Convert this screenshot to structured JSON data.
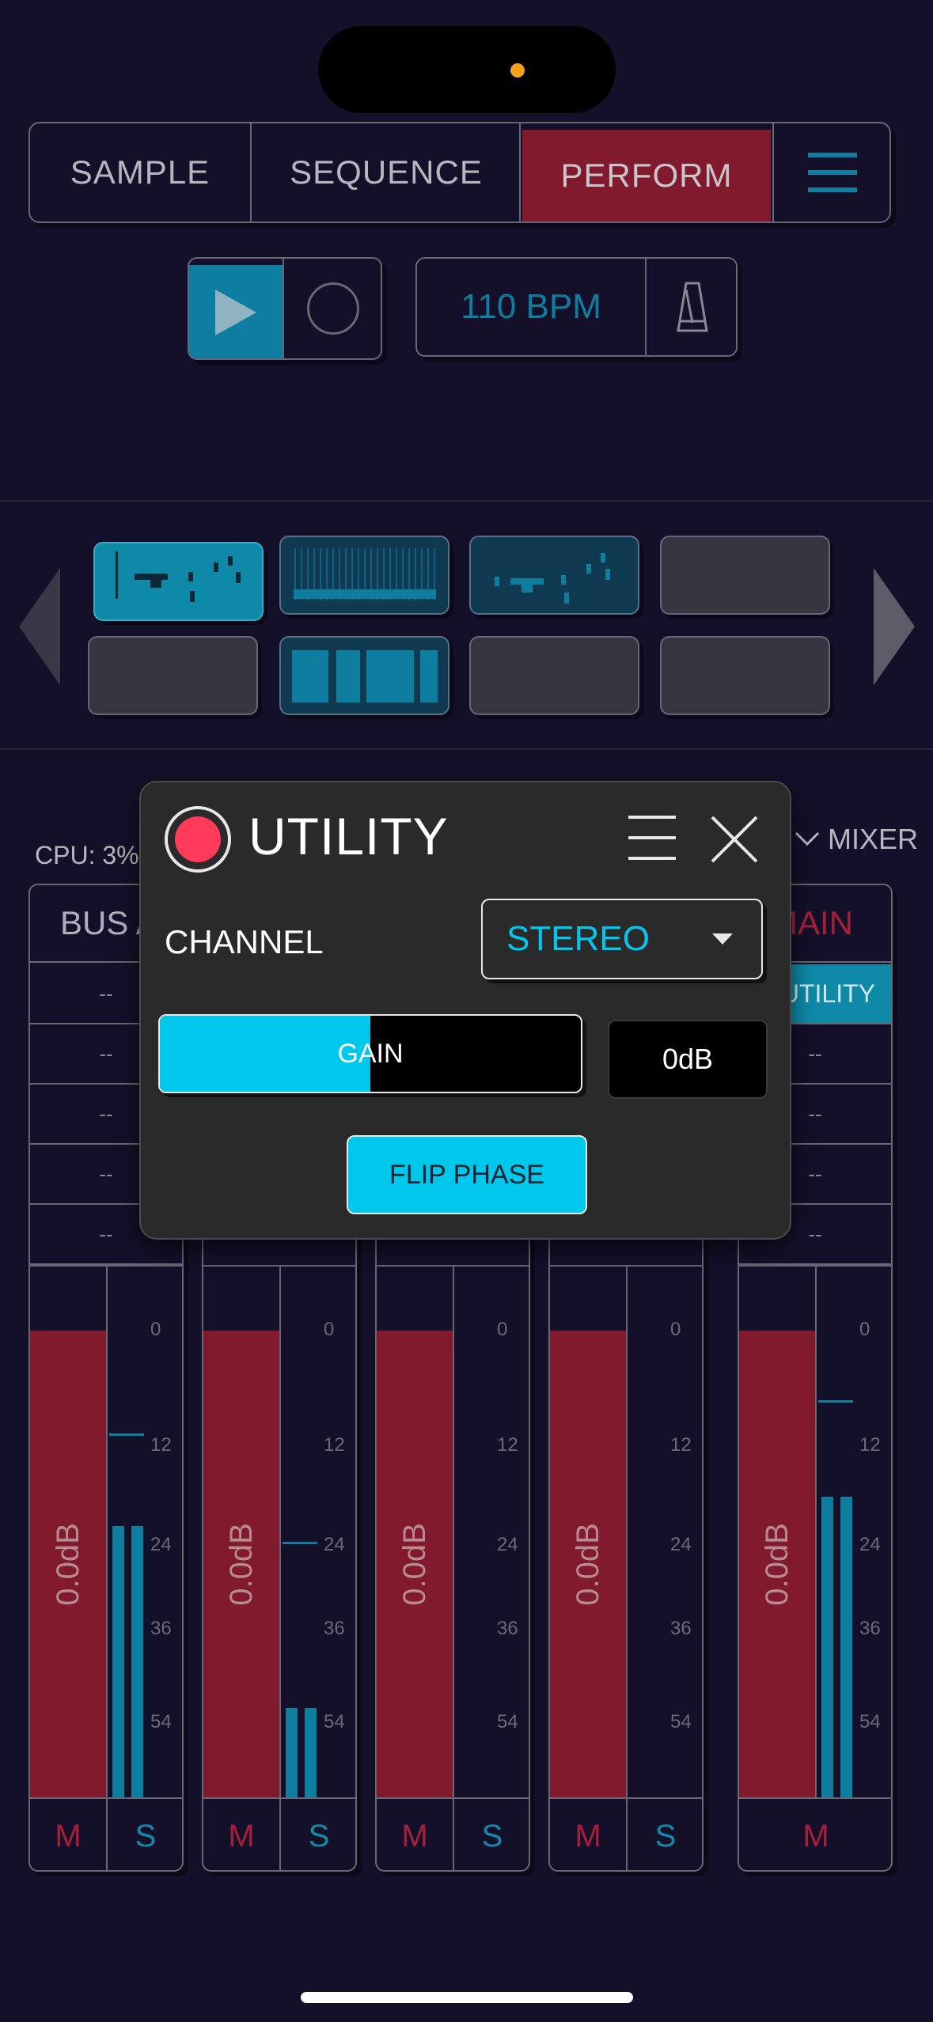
{
  "colors": {
    "background": "#15102a",
    "accent_red": "#821a2d",
    "accent_teal": "#0e7ea0",
    "popup_cyan": "#00c8ec",
    "record_red": "#ff3a5a",
    "notch_dot": "#f5a11c"
  },
  "tabs": {
    "sample": "SAMPLE",
    "sequence": "SEQUENCE",
    "perform": "PERFORM",
    "perform_color": "#821a2d",
    "menu_icon": "hamburger-icon"
  },
  "transport": {
    "play_icon": "play-icon",
    "record_icon": "record-icon",
    "bpm": "110 BPM",
    "metronome_icon": "metronome-icon"
  },
  "patterns": {
    "left_arrow_icon": "chevron-left-icon",
    "right_arrow_icon": "chevron-right-icon"
  },
  "status": {
    "cpu": "CPU: 3%",
    "mixer_label": "MIXER",
    "mixer_icon": "chevron-down-icon"
  },
  "channels": [
    {
      "name": "BUS A",
      "fader": "0.0dB",
      "mute": "M",
      "solo": "S",
      "slots": [
        "--",
        "--",
        "--",
        "--",
        "--"
      ]
    },
    {
      "name": "",
      "fader": "0.0dB",
      "mute": "M",
      "solo": "S"
    },
    {
      "name": "",
      "fader": "0.0dB",
      "mute": "M",
      "solo": "S"
    },
    {
      "name": "",
      "fader": "0.0dB",
      "mute": "M",
      "solo": "S"
    },
    {
      "name": "MAIN",
      "fader": "0.0dB",
      "mute": "M",
      "slots": [
        "UTILITY",
        "--",
        "--",
        "--",
        "--"
      ]
    }
  ],
  "meter_scale": [
    "0",
    "12",
    "24",
    "36",
    "54"
  ],
  "utility_popup": {
    "title": "UTILITY",
    "channel_label": "CHANNEL",
    "channel_value": "STEREO",
    "gain_label": "GAIN",
    "gain_level": 0.5,
    "gain_value": "0dB",
    "flip_phase": "FLIP PHASE",
    "menu_icon": "hamburger-icon",
    "close_icon": "close-icon"
  }
}
